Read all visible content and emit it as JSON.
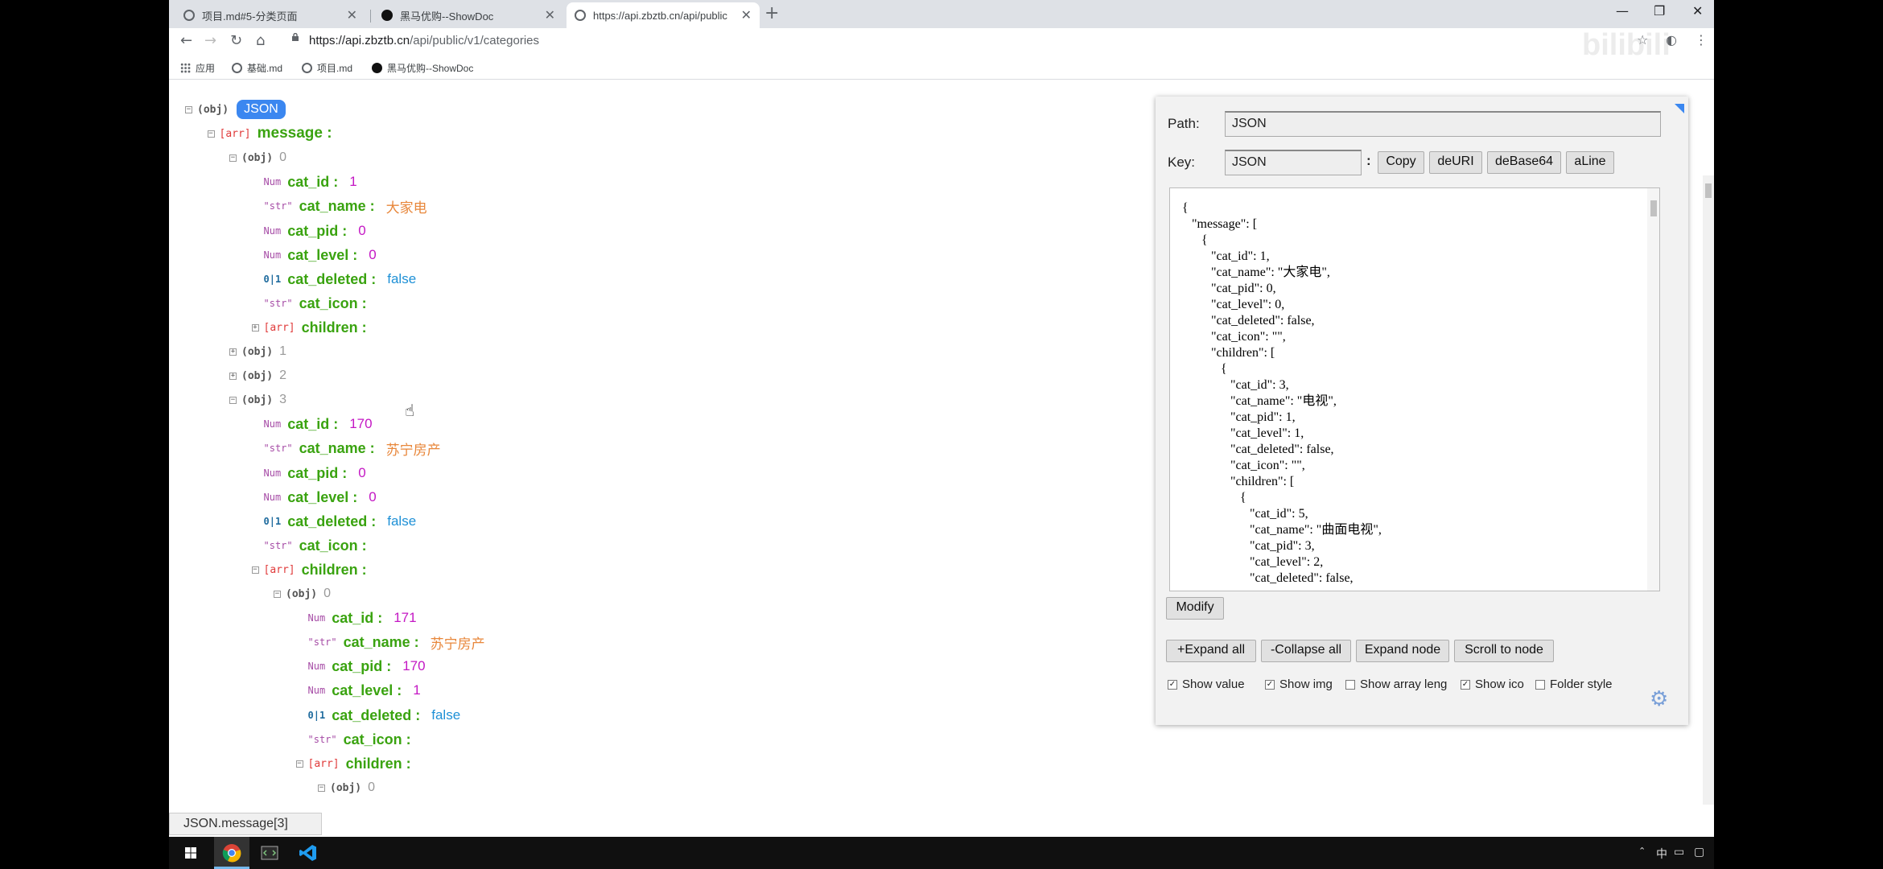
{
  "tabs": [
    {
      "label": "项目.md#5-分类页面",
      "active": false
    },
    {
      "label": "黑马优购--ShowDoc",
      "active": false
    },
    {
      "label": "https://api.zbztb.cn/api/public",
      "active": true
    }
  ],
  "window": {
    "minimize": "—",
    "maximize": "❐",
    "close": "✕",
    "newtab": "+"
  },
  "address": {
    "host": "https://api.zbztb.cn",
    "path": "/api/public/v1/categories"
  },
  "bookmarks": [
    {
      "label": "应用",
      "icon": "apps-grid-icon"
    },
    {
      "label": "基础.md",
      "icon": "globe-icon"
    },
    {
      "label": "项目.md",
      "icon": "globe-icon"
    },
    {
      "label": "黑马优购--ShowDoc",
      "icon": "showdoc-icon"
    }
  ],
  "tree": {
    "root_type": "(obj)",
    "root_label": "JSON",
    "types": {
      "obj": "(obj)",
      "arr": "[arr]",
      "num": "Num",
      "str": "\"str\"",
      "bool": "0|1"
    },
    "nodes": [
      {
        "depth": 1,
        "kind": "arr",
        "key": "message :",
        "toggle": "⊟"
      },
      {
        "depth": 2,
        "kind": "obj",
        "idx": "0",
        "toggle": "⊟"
      },
      {
        "depth": 3,
        "kind": "num",
        "key": "cat_id :",
        "value": "1"
      },
      {
        "depth": 3,
        "kind": "str",
        "key": "cat_name :",
        "value": "大家电"
      },
      {
        "depth": 3,
        "kind": "num",
        "key": "cat_pid :",
        "value": "0"
      },
      {
        "depth": 3,
        "kind": "num",
        "key": "cat_level :",
        "value": "0"
      },
      {
        "depth": 3,
        "kind": "bool",
        "key": "cat_deleted :",
        "value": "false"
      },
      {
        "depth": 3,
        "kind": "str",
        "key": "cat_icon :",
        "value": ""
      },
      {
        "depth": 3,
        "kind": "arr",
        "key": "children :",
        "toggle": "⊞"
      },
      {
        "depth": 2,
        "kind": "obj",
        "idx": "1",
        "toggle": "⊞"
      },
      {
        "depth": 2,
        "kind": "obj",
        "idx": "2",
        "toggle": "⊞"
      },
      {
        "depth": 2,
        "kind": "obj",
        "idx": "3",
        "toggle": "⊟"
      },
      {
        "depth": 3,
        "kind": "num",
        "key": "cat_id :",
        "value": "170"
      },
      {
        "depth": 3,
        "kind": "str",
        "key": "cat_name :",
        "value": "苏宁房产"
      },
      {
        "depth": 3,
        "kind": "num",
        "key": "cat_pid :",
        "value": "0"
      },
      {
        "depth": 3,
        "kind": "num",
        "key": "cat_level :",
        "value": "0"
      },
      {
        "depth": 3,
        "kind": "bool",
        "key": "cat_deleted :",
        "value": "false"
      },
      {
        "depth": 3,
        "kind": "str",
        "key": "cat_icon :",
        "value": ""
      },
      {
        "depth": 3,
        "kind": "arr",
        "key": "children :",
        "toggle": "⊟"
      },
      {
        "depth": 4,
        "kind": "obj",
        "idx": "0",
        "toggle": "⊟"
      },
      {
        "depth": 5,
        "kind": "num",
        "key": "cat_id :",
        "value": "171"
      },
      {
        "depth": 5,
        "kind": "str",
        "key": "cat_name :",
        "value": "苏宁房产"
      },
      {
        "depth": 5,
        "kind": "num",
        "key": "cat_pid :",
        "value": "170"
      },
      {
        "depth": 5,
        "kind": "num",
        "key": "cat_level :",
        "value": "1"
      },
      {
        "depth": 5,
        "kind": "bool",
        "key": "cat_deleted :",
        "value": "false"
      },
      {
        "depth": 5,
        "kind": "str",
        "key": "cat_icon :",
        "value": ""
      },
      {
        "depth": 5,
        "kind": "arr",
        "key": "children :",
        "toggle": "⊟"
      },
      {
        "depth": 6,
        "kind": "obj",
        "idx": "0",
        "toggle": "⊟"
      }
    ]
  },
  "panel": {
    "path_label": "Path:",
    "path_value": "JSON",
    "key_label": "Key:",
    "key_value": "JSON",
    "colon": ":",
    "buttons": [
      "Copy",
      "deURI",
      "deBase64",
      "aLine"
    ],
    "code": "{\n   \"message\": [\n      {\n         \"cat_id\": 1,\n         \"cat_name\": \"大家电\",\n         \"cat_pid\": 0,\n         \"cat_level\": 0,\n         \"cat_deleted\": false,\n         \"cat_icon\": \"\",\n         \"children\": [\n            {\n               \"cat_id\": 3,\n               \"cat_name\": \"电视\",\n               \"cat_pid\": 1,\n               \"cat_level\": 1,\n               \"cat_deleted\": false,\n               \"cat_icon\": \"\",\n               \"children\": [\n                  {\n                     \"cat_id\": 5,\n                     \"cat_name\": \"曲面电视\",\n                     \"cat_pid\": 3,\n                     \"cat_level\": 2,\n                     \"cat_deleted\": false,",
    "modify": "Modify",
    "actions": [
      "+Expand all",
      "-Collapse all",
      "Expand node",
      "Scroll to node"
    ],
    "options": [
      {
        "label": "Show value",
        "checked": true
      },
      {
        "label": "Show img",
        "checked": true
      },
      {
        "label": "Show array leng",
        "checked": false
      },
      {
        "label": "Show ico",
        "checked": true
      },
      {
        "label": "Folder style",
        "checked": false
      }
    ]
  },
  "status_bar": "JSON.message[3]",
  "tray": {
    "ime": "中"
  },
  "colors": {
    "key": "#3aa310",
    "num": "#c418c4",
    "str": "#e8873b",
    "bool": "#1e90d6",
    "badge": "#3b87f0"
  }
}
